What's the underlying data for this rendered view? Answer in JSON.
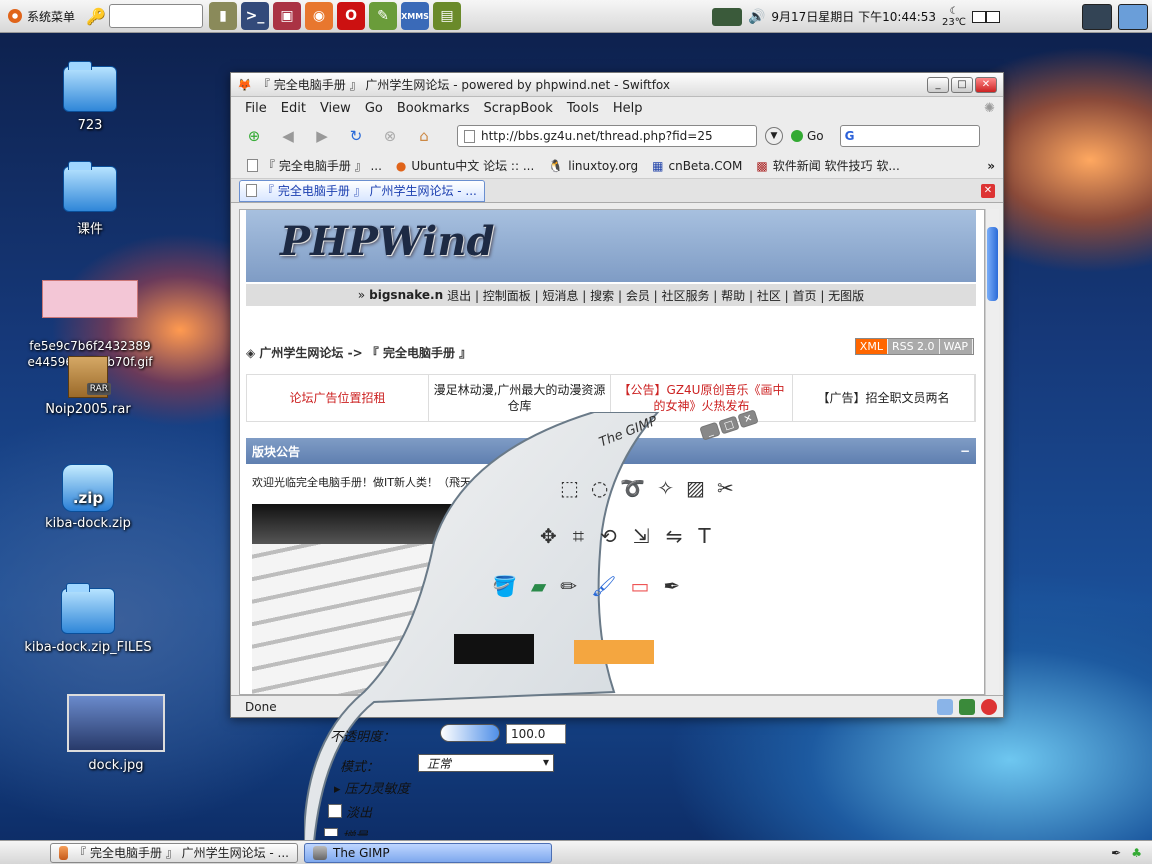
{
  "topbar": {
    "menu_label": "系统菜单",
    "clock": "9月17日星期日 下午10:44:53",
    "temperature": "23℃",
    "launcher_icons": [
      "file-cabinet-icon",
      "terminal-icon",
      "network-icon",
      "firefox-icon",
      "opera-icon",
      "graphics-icon",
      "xmms-icon",
      "book-icon"
    ],
    "xmms_label": "XMMS"
  },
  "desktop": {
    "icons": [
      {
        "name": "723",
        "type": "folder"
      },
      {
        "name": "课件",
        "type": "folder"
      },
      {
        "name": "fe5e9c7b6f2432389\ne44596edf9eb70f.gif",
        "type": "image"
      },
      {
        "name": "Noip2005.rar",
        "type": "archive"
      },
      {
        "name": "kiba-dock.zip",
        "type": "zip"
      },
      {
        "name": "kiba-dock.zip_FILES",
        "type": "folder"
      },
      {
        "name": "dock.jpg",
        "type": "image"
      }
    ],
    "rar_badge": "RAR",
    "zip_badge": ".zip"
  },
  "browser": {
    "title": "『 完全电脑手册 』 广州学生网论坛 - powered  by  phpwind.net - Swiftfox",
    "menus": [
      "File",
      "Edit",
      "View",
      "Go",
      "Bookmarks",
      "ScrapBook",
      "Tools",
      "Help"
    ],
    "url": "http://bbs.gz4u.net/thread.php?fid=25",
    "go_label": "Go",
    "search_engine_glyph": "G",
    "bookmarks": [
      "『 完全电脑手册 』 ...",
      "Ubuntu中文 论坛 :: ...",
      "linuxtoy.org",
      "cnBeta.COM",
      "软件新闻 软件技巧 软..."
    ],
    "more_glyph": "»",
    "tab": "『 完全电脑手册 』 广州学生网论坛 - ...",
    "status": "Done"
  },
  "page": {
    "logo": "PHPWind",
    "user": "bigsnake.n",
    "user_links": "退出 | 控制面板 | 短消息 | 搜索 | 会员 | 社区服务 | 帮助 | 社区 | 首页 | 无图版",
    "breadcrumb": "广州学生网论坛 -> 『 完全电脑手册 』",
    "feeds": [
      "XML",
      "RSS 2.0",
      "WAP"
    ],
    "ads": [
      "论坛广告位置招租",
      "漫足林动漫,广州最大的动漫资源仓库",
      "【公告】GZ4U原创音乐《画中的女神》火热发布",
      "【广告】招全职文员两名"
    ],
    "board_title": "版块公告",
    "notice": "欢迎光临完全电脑手册！做IT新人类！（飛天大稻: 2005"
  },
  "gimp": {
    "title": "The GIMP",
    "opacity_label": "不透明度：",
    "opacity_value": "100.0",
    "mode_label": "模式：",
    "mode_value": "正常",
    "pressure_label": "压力灵敏度",
    "fade_label": "淡出",
    "increment_label": "增量"
  },
  "taskbar": {
    "tasks": [
      "『 完全电脑手册 』 广州学生网论坛 - ...",
      "The GIMP"
    ]
  },
  "colors": {
    "accent": "#5f7fb0",
    "ad_red": "#cc2222",
    "tab_blue": "#1b3fb0",
    "xml_orange": "#ff6600"
  }
}
